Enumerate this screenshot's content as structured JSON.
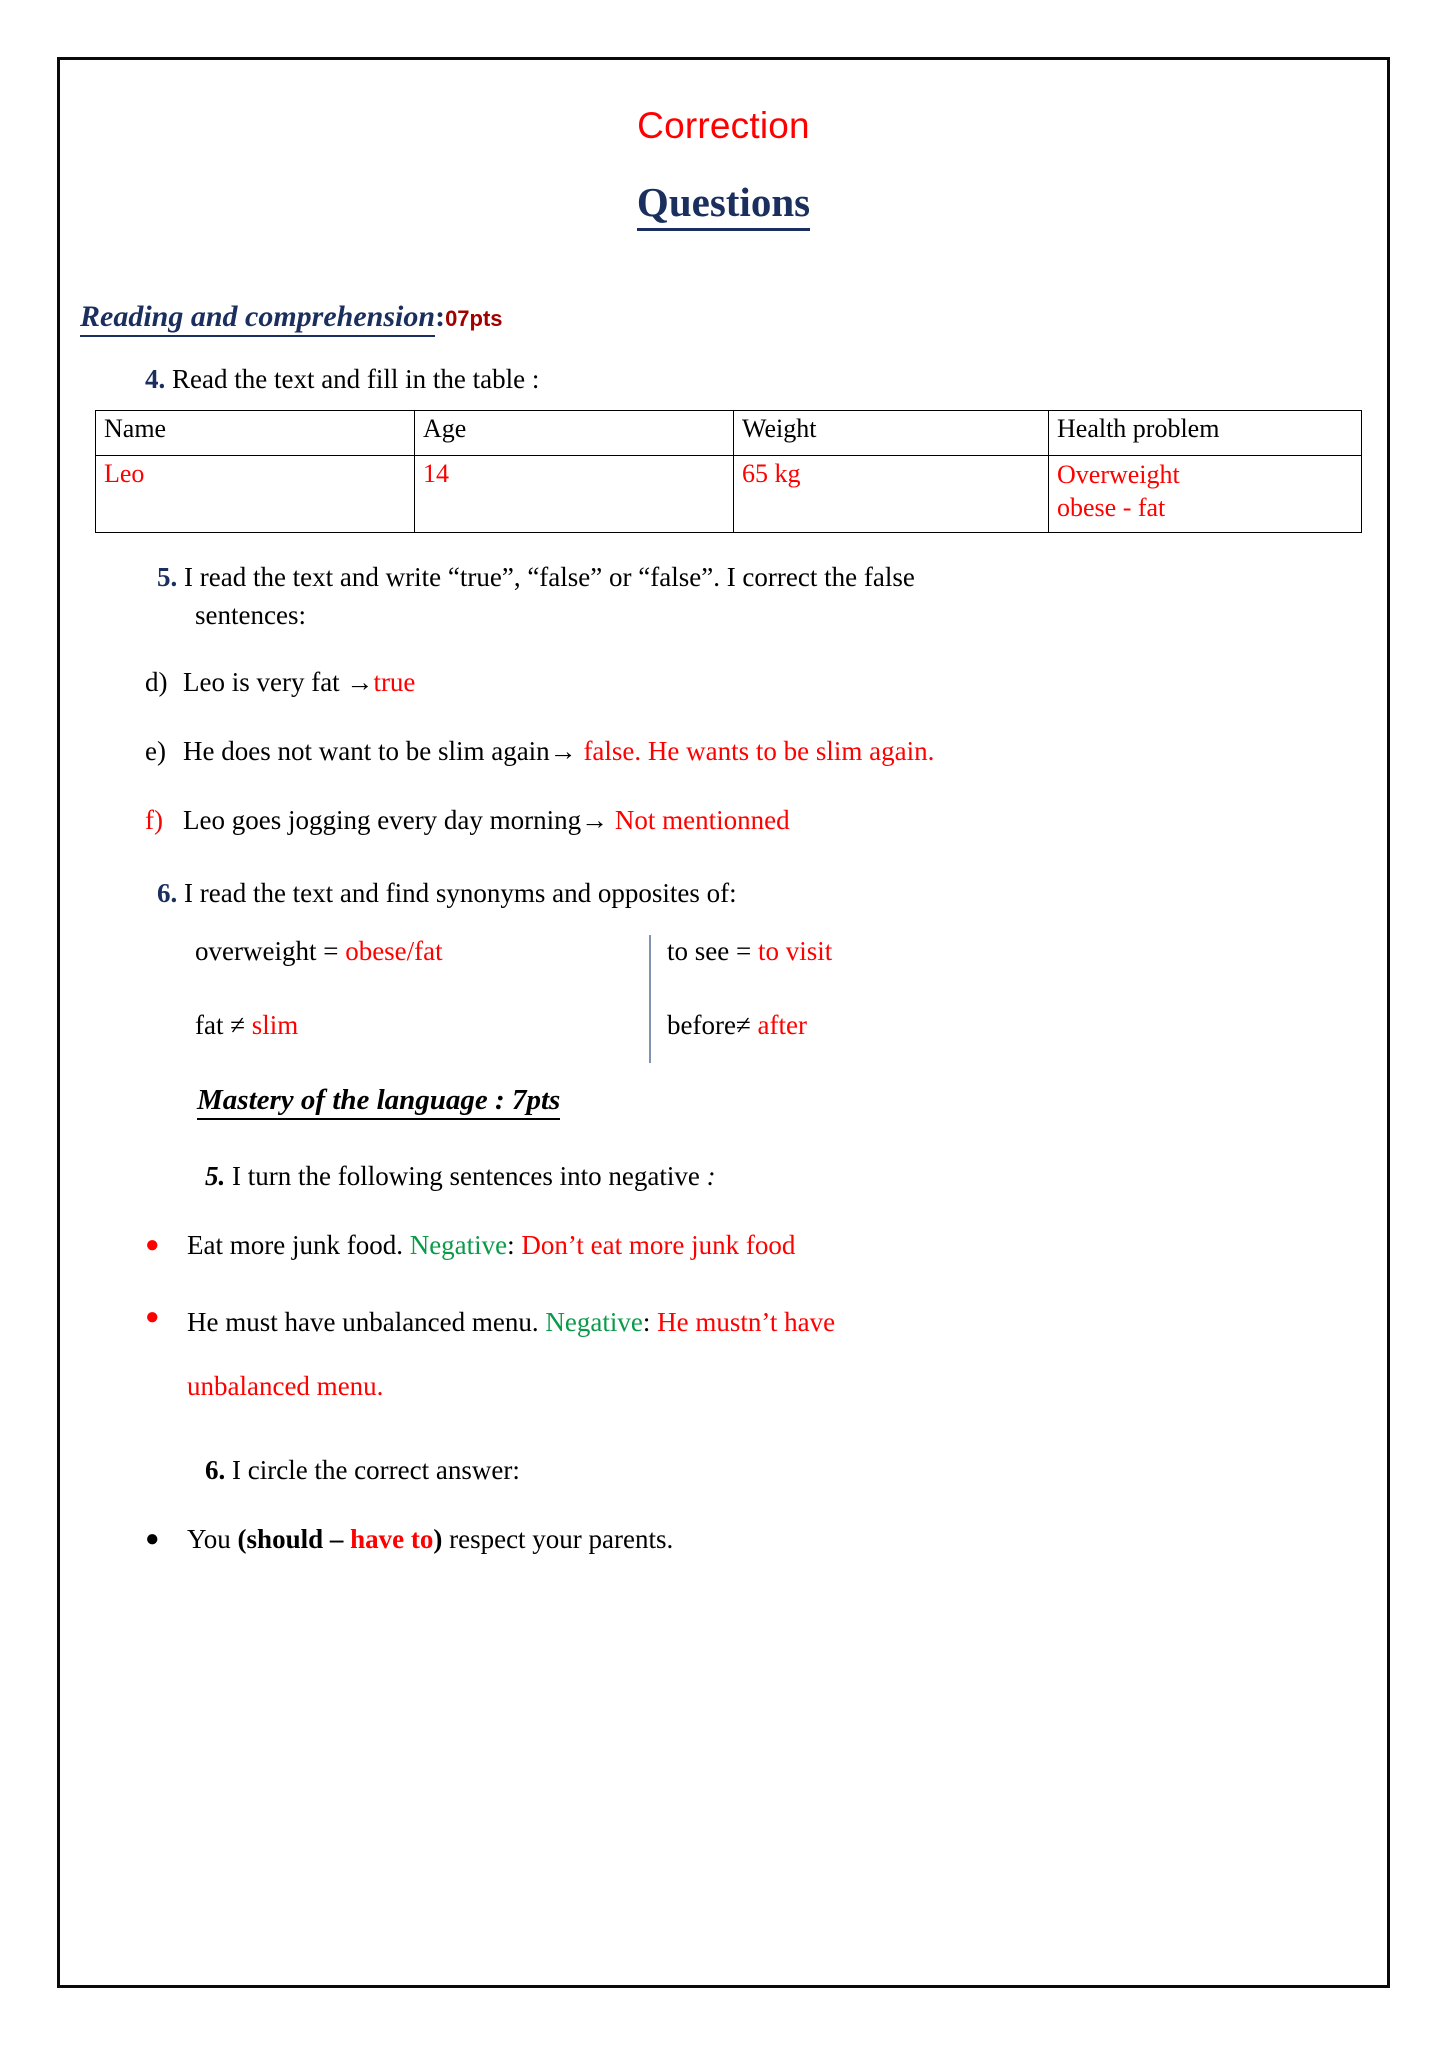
{
  "document": {
    "title_correction": "Correction",
    "title_questions": "Questions"
  },
  "section1": {
    "heading": "Reading and comprehension",
    "heading_colon": ":",
    "points": "07pts",
    "q4": {
      "number": "4.",
      "text": "Read the text and fill in the table :"
    },
    "table": {
      "headers": [
        "Name",
        "Age",
        "Weight",
        "Health problem"
      ],
      "row": {
        "name": "Leo",
        "age": "14",
        "weight": "65 kg",
        "health_line1": "Overweight",
        "health_line2": "obese - fat"
      }
    },
    "q5": {
      "number": "5.",
      "text": "I read the text and write “true”, “false” or “false”. I correct the false",
      "text_cont": "sentences:",
      "items": [
        {
          "label": "d)",
          "label_color": "black",
          "statement": "Leo is very fat →",
          "answer": "true",
          "answer_extra": ""
        },
        {
          "label": "e)",
          "label_color": "black",
          "statement": "He does not want to be slim again→ ",
          "answer": "false.",
          "answer_extra": " He wants to be slim again."
        },
        {
          "label": "f)",
          "label_color": "red",
          "statement": "Leo goes jogging every day morning→ ",
          "answer": "Not mentionned",
          "answer_extra": ""
        }
      ]
    },
    "q6": {
      "number": "6.",
      "text": "I read the text and find synonyms and opposites of:",
      "pairs": [
        {
          "left_term": "overweight  = ",
          "left_answer": "obese/fat",
          "right_term": "to see = ",
          "right_answer": "to visit"
        },
        {
          "left_term": "fat ≠ ",
          "left_answer": "slim",
          "right_term": "before≠  ",
          "right_answer": "after"
        }
      ]
    }
  },
  "section2": {
    "heading": "Mastery of the language : 7pts",
    "q5": {
      "number": "5.",
      "text": "I turn the following sentences into negative ",
      "text_end": ":"
    },
    "negatives": [
      {
        "prompt": "Eat more junk food. ",
        "label": "Negative",
        "colon": ": ",
        "answer": "Don’t eat more junk food",
        "answer_line2": ""
      },
      {
        "prompt": "He   must   have   unbalanced   menu.   ",
        "label": "Negative",
        "colon": ": ",
        "answer": "He   mustn’t   have",
        "answer_line2": "unbalanced menu."
      }
    ],
    "q6": {
      "number": "6.",
      "text": "I circle the correct answer:"
    },
    "circle_item": {
      "prefix": "You ",
      "open_paren": "(",
      "option1": "should",
      "separator": " – ",
      "option2": "have to",
      "close_paren": ")",
      "suffix": " respect your parents."
    }
  },
  "colors": {
    "red": "#ff0000",
    "navy": "#1b2f5e",
    "dark_red": "#a00000",
    "green": "#0a9b49",
    "divider": "#8193ad"
  }
}
